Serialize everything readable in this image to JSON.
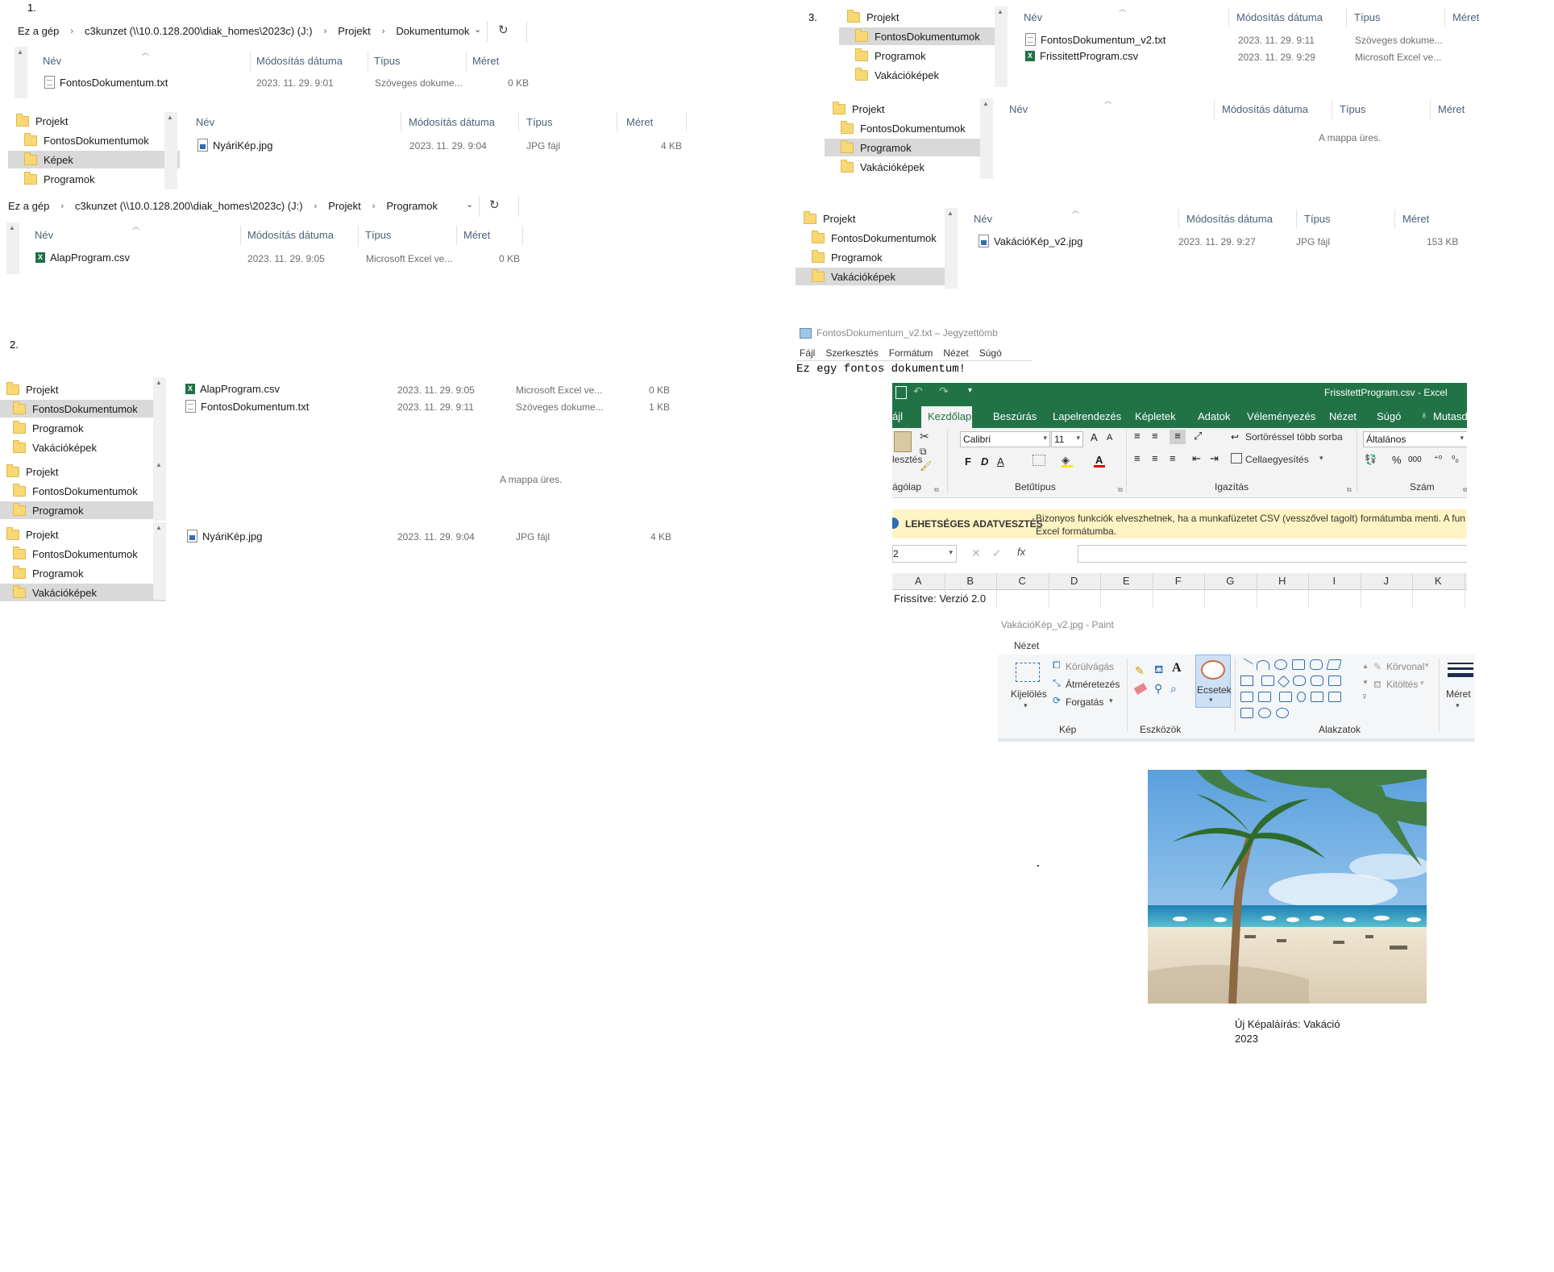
{
  "section_labels": {
    "s1": "1.",
    "s2": "2.",
    "s3": "3."
  },
  "explorer_common": {
    "col_name": "Név",
    "col_date": "Módosítás dátuma",
    "col_type": "Típus",
    "col_size": "Méret",
    "empty_folder": "A mappa üres.",
    "refresh_icon": "refresh-icon",
    "folder_icon": "folder-icon"
  },
  "win1": {
    "breadcrumb": [
      "Ez a gép",
      "c3kunzet (\\\\10.0.128.200\\diak_homes\\2023c) (J:)",
      "Projekt",
      "Dokumentumok"
    ],
    "files": [
      {
        "name": "FontosDokumentum.txt",
        "date": "2023. 11. 29. 9:01",
        "type": "Szöveges dokume...",
        "size": "0 KB",
        "icon": "text-file-icon"
      }
    ]
  },
  "win1b": {
    "tree": [
      "Projekt",
      "FontosDokumentumok",
      "Képek",
      "Programok"
    ],
    "selected": "Képek",
    "files": [
      {
        "name": "NyáriKép.jpg",
        "date": "2023. 11. 29. 9:04",
        "type": "JPG fájl",
        "size": "4 KB",
        "icon": "image-file-icon"
      }
    ]
  },
  "win1c": {
    "breadcrumb": [
      "Ez a gép",
      "c3kunzet (\\\\10.0.128.200\\diak_homes\\2023c) (J:)",
      "Projekt",
      "Programok"
    ],
    "files": [
      {
        "name": "AlapProgram.csv",
        "date": "2023. 11. 29. 9:05",
        "type": "Microsoft Excel ve...",
        "size": "0 KB",
        "icon": "excel-file-icon"
      }
    ]
  },
  "win2a": {
    "tree": [
      "Projekt",
      "FontosDokumentumok",
      "Programok",
      "Vakációképek"
    ],
    "selected": "FontosDokumentumok",
    "files": [
      {
        "name": "AlapProgram.csv",
        "date": "2023. 11. 29. 9:05",
        "type": "Microsoft Excel ve...",
        "size": "0 KB",
        "icon": "excel-file-icon"
      },
      {
        "name": "FontosDokumentum.txt",
        "date": "2023. 11. 29. 9:11",
        "type": "Szöveges dokume...",
        "size": "1 KB",
        "icon": "text-file-icon"
      }
    ]
  },
  "win2b": {
    "tree": [
      "Projekt",
      "FontosDokumentumok",
      "Programok"
    ],
    "selected": "Programok"
  },
  "win2c": {
    "tree": [
      "Projekt",
      "FontosDokumentumok",
      "Programok",
      "Vakációképek"
    ],
    "selected": "Vakációképek",
    "files": [
      {
        "name": "NyáriKép.jpg",
        "date": "2023. 11. 29. 9:04",
        "type": "JPG fájl",
        "size": "4 KB",
        "icon": "image-file-icon"
      }
    ]
  },
  "win3a": {
    "tree": [
      "Projekt",
      "FontosDokumentumok",
      "Programok",
      "Vakációképek"
    ],
    "selected": "FontosDokumentumok",
    "files": [
      {
        "name": "FontosDokumentum_v2.txt",
        "date": "2023. 11. 29. 9:11",
        "type": "Szöveges dokume...",
        "icon": "text-file-icon"
      },
      {
        "name": "FrissitettProgram.csv",
        "date": "2023. 11. 29. 9:29",
        "type": "Microsoft Excel ve...",
        "icon": "excel-file-icon"
      }
    ]
  },
  "win3b": {
    "tree": [
      "Projekt",
      "FontosDokumentumok",
      "Programok",
      "Vakációképek"
    ],
    "selected": "Programok"
  },
  "win3c": {
    "tree": [
      "Projekt",
      "FontosDokumentumok",
      "Programok",
      "Vakációképek"
    ],
    "selected": "Vakációképek",
    "files": [
      {
        "name": "VakációKép_v2.jpg",
        "date": "2023. 11. 29. 9:27",
        "type": "JPG fájl",
        "size": "153 KB",
        "icon": "image-file-icon"
      }
    ]
  },
  "notepad": {
    "title": "FontosDokumentum_v2.txt – Jegyzettömb",
    "menu": [
      "Fájl",
      "Szerkesztés",
      "Formátum",
      "Nézet",
      "Súgó"
    ],
    "content": "Ez egy fontos dokumentum!"
  },
  "excel": {
    "title": "FrissitettProgram.csv - Excel",
    "tabs": [
      "ájl",
      "Kezdőlap",
      "Beszúrás",
      "Lapelrendezés",
      "Képletek",
      "Adatok",
      "Véleményezés",
      "Nézet",
      "Súgó",
      "Mutasd"
    ],
    "active_tab": "Kezdőlap",
    "font_name": "Calibri",
    "font_size": "11",
    "paste_label": "lesztés",
    "wrap_label": "Sortöréssel több sorba",
    "merge_label": "Cellaegyesítés",
    "number_format": "Általános",
    "groups": [
      "ágólap",
      "Betűtípus",
      "Igazítás",
      "Szám"
    ],
    "bold": "F",
    "italic": "D",
    "underline": "A",
    "font_color_label": "A",
    "grow_font": "A",
    "shrink_font": "A",
    "percent": "%",
    "thousands": "000",
    "warning_title": "LEHETSÉGES ADATVESZTÉS",
    "warning_text": "Bizonyos funkciók elveszhetnek, ha a munkafüzetet CSV (vesszővel tagolt) formátumba menti. A fun Excel formátumba.",
    "name_box": "2",
    "fx": "fx",
    "columns": [
      "A",
      "B",
      "C",
      "D",
      "E",
      "F",
      "G",
      "H",
      "I",
      "J",
      "K"
    ],
    "cell_a1": "Frissítve: Verzió 2.0",
    "brand_color": "#217346"
  },
  "paint": {
    "title": "VakációKép_v2.jpg - Paint",
    "menu_tab": "Nézet",
    "crop": "Körülvágás",
    "resize": "Átméretezés",
    "rotate": "Forgatás",
    "select": "Kijelölés",
    "brushes": "Ecsetek",
    "outline": "Körvonal",
    "fill": "Kitöltés",
    "size": "Méret",
    "text_tool": "A",
    "groups": [
      "Kép",
      "Eszközök",
      "Alakzatok"
    ]
  },
  "photo": {
    "caption_line1": "Új Képaláírás: Vakáció",
    "caption_line2": "2023"
  }
}
